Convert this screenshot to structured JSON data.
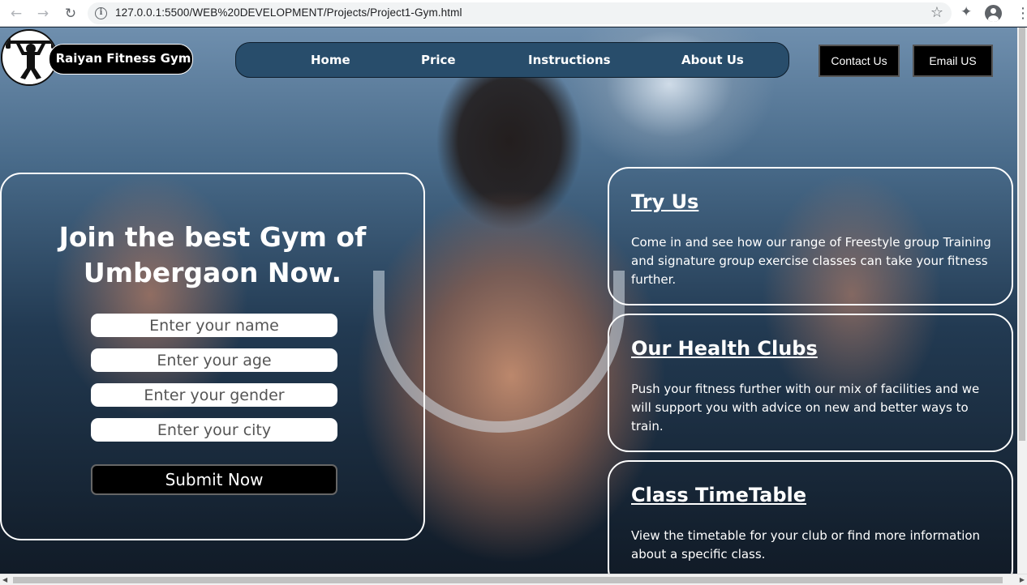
{
  "browser": {
    "url": "127.0.0.1:5500/WEB%20DEVELOPMENT/Projects/Project1-Gym.html"
  },
  "header": {
    "brand": "Raiyan Fitness Gym",
    "nav": [
      "Home",
      "Price",
      "Instructions",
      "About Us"
    ],
    "contact_label": "Contact Us",
    "email_label": "Email US"
  },
  "form": {
    "title": "Join the best Gym of Umbergaon Now.",
    "name_placeholder": "Enter your name",
    "age_placeholder": "Enter your age",
    "gender_placeholder": "Enter your gender",
    "city_placeholder": "Enter your city",
    "submit_label": "Submit Now"
  },
  "cards": [
    {
      "title": "Try Us",
      "text": "Come in and see how our range of Freestyle group Training and signature group exercise classes can take your fitness further."
    },
    {
      "title": "Our Health Clubs",
      "text": "Push your fitness further with our mix of facilities and we will support you with advice on new and better ways to train."
    },
    {
      "title": "Class TimeTable",
      "text": "View the timetable for your club or find more information about a specific class."
    }
  ],
  "colors": {
    "nav_bg": "#284d6b",
    "button_bg": "#000000",
    "text": "#ffffff"
  }
}
